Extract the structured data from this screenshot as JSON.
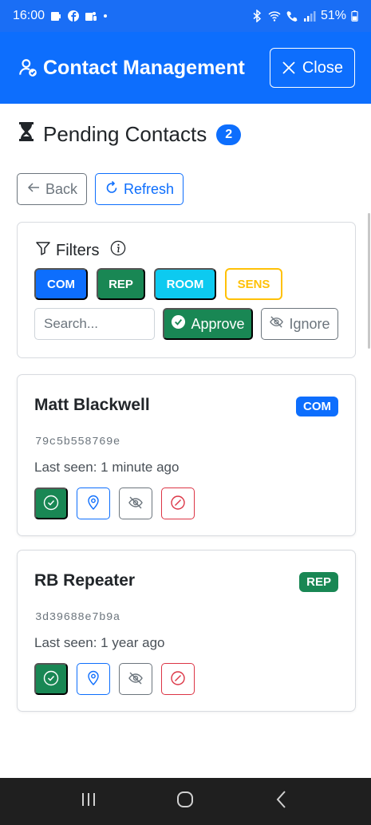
{
  "status_bar": {
    "time": "16:00",
    "battery": "51%",
    "icons": [
      "sim-card-icon",
      "facebook-icon",
      "teams-icon",
      "dot-icon",
      "bluetooth-icon",
      "wifi-icon",
      "call-icon",
      "signal-icon",
      "battery-icon"
    ]
  },
  "header": {
    "title": "Contact Management",
    "close_label": "Close",
    "icons": [
      "user-check-icon",
      "close-x-icon"
    ]
  },
  "page": {
    "title": "Pending Contacts",
    "count": "2"
  },
  "actions": {
    "back_label": "Back",
    "refresh_label": "Refresh"
  },
  "filters": {
    "title": "Filters",
    "chips": [
      {
        "label": "COM",
        "color": "#0d6efd"
      },
      {
        "label": "REP",
        "color": "#198754"
      },
      {
        "label": "ROOM",
        "color": "#0dcaf0"
      },
      {
        "label": "SENS",
        "color": "#ffc107"
      }
    ],
    "search_placeholder": "Search...",
    "approve_label": "Approve",
    "ignore_label": "Ignore"
  },
  "contacts": [
    {
      "name": "Matt Blackwell",
      "type": "COM",
      "type_color": "#0d6efd",
      "id": "79c5b558769e",
      "last_seen": "Last seen: 1 minute ago"
    },
    {
      "name": "RB Repeater",
      "type": "REP",
      "type_color": "#198754",
      "id": "3d39688e7b9a",
      "last_seen": "Last seen: 1 year ago"
    }
  ],
  "colors": {
    "primary": "#0d6efd",
    "success": "#198754",
    "info": "#0dcaf0",
    "warning": "#ffc107",
    "danger": "#dc3545",
    "secondary": "#6c757d"
  }
}
